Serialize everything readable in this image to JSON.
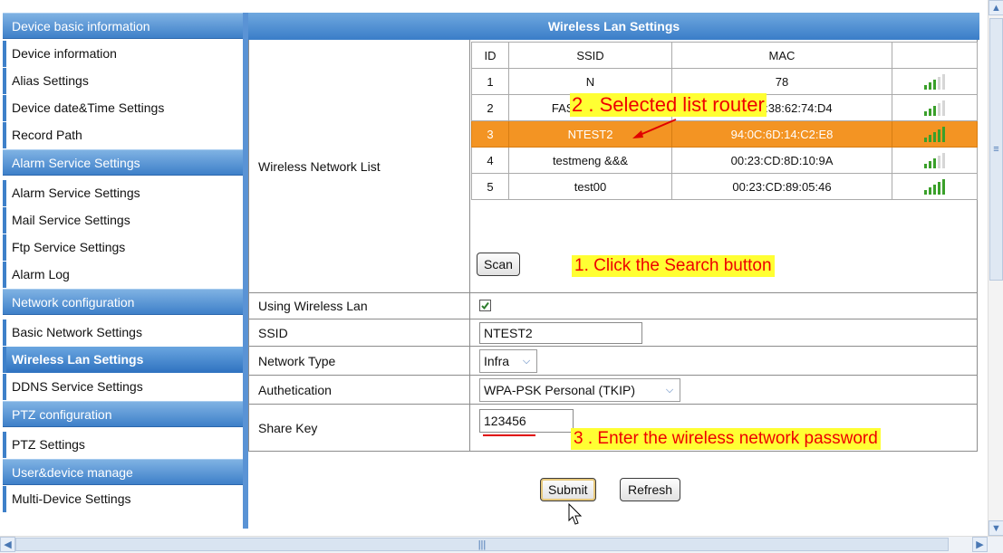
{
  "sidebar": {
    "rows": [
      {
        "label": "Device basic information",
        "kind": "section"
      },
      {
        "label": "Device information",
        "kind": "item"
      },
      {
        "label": "Alias Settings",
        "kind": "item"
      },
      {
        "label": "Device date&Time Settings",
        "kind": "item"
      },
      {
        "label": "Record Path",
        "kind": "item"
      },
      {
        "label": "Alarm Service Settings",
        "kind": "section"
      },
      {
        "label": "Alarm Service Settings",
        "kind": "item"
      },
      {
        "label": "Mail Service Settings",
        "kind": "item"
      },
      {
        "label": "Ftp Service Settings",
        "kind": "item"
      },
      {
        "label": "Alarm Log",
        "kind": "item"
      },
      {
        "label": "Network configuration",
        "kind": "section"
      },
      {
        "label": "Basic Network Settings",
        "kind": "item"
      },
      {
        "label": "Wireless Lan Settings",
        "kind": "item",
        "active": true
      },
      {
        "label": "DDNS Service Settings",
        "kind": "item"
      },
      {
        "label": "PTZ configuration",
        "kind": "section"
      },
      {
        "label": "PTZ Settings",
        "kind": "item"
      },
      {
        "label": "User&device manage",
        "kind": "section"
      },
      {
        "label": "Multi-Device Settings",
        "kind": "item"
      }
    ]
  },
  "main": {
    "title": "Wireless Lan Settings",
    "network_list_label": "Wireless Network List",
    "table": {
      "headers": [
        "ID",
        "SSID",
        "MAC",
        ""
      ],
      "rows": [
        {
          "id": "1",
          "ssid": "N",
          "mac": "78",
          "signal": 3
        },
        {
          "id": "2",
          "ssid": "FAST_6274D4",
          "mac": "F4:EC:38:62:74:D4",
          "signal": 3
        },
        {
          "id": "3",
          "ssid": "NTEST2",
          "mac": "94:0C:6D:14:C2:E8",
          "signal": 5,
          "selected": true
        },
        {
          "id": "4",
          "ssid": "testmeng &&&",
          "mac": "00:23:CD:8D:10:9A",
          "signal": 3
        },
        {
          "id": "5",
          "ssid": "test00",
          "mac": "00:23:CD:89:05:46",
          "signal": 5
        }
      ]
    },
    "scan_label": "Scan",
    "using_wireless_label": "Using Wireless Lan",
    "using_wireless_checked": true,
    "ssid_label": "SSID",
    "ssid_value": "NTEST2",
    "network_type_label": "Network Type",
    "network_type_value": "Infra",
    "auth_label": "Authetication",
    "auth_value": "WPA-PSK Personal (TKIP)",
    "share_key_label": "Share Key",
    "share_key_value": "123456",
    "submit_label": "Submit",
    "refresh_label": "Refresh"
  },
  "annotations": {
    "step2": "2 . Selected list router",
    "step1": "1. Click the Search button",
    "step3": "3 . Enter the wireless network password"
  },
  "colors": {
    "accent_blue": "#3e80c9",
    "selected_row": "#f39423",
    "signal_green": "#3aa02a",
    "note_bg": "#ffff33",
    "note_text": "#e00000"
  }
}
